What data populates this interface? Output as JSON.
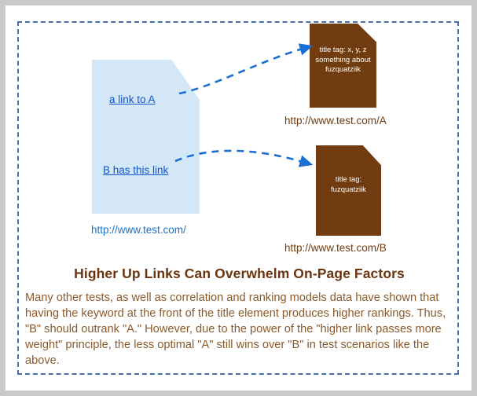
{
  "colors": {
    "frame_outer": "#c9c9c9",
    "frame_dashed": "#4a6fa8",
    "page_blue": "#d4e7f7",
    "page_brown": "#703c10",
    "link_blue": "#1155cc",
    "arrow_blue": "#1a6fd4",
    "headline_brown": "#6b3410",
    "body_brown": "#8a5a2b"
  },
  "diagram": {
    "source_page": {
      "name": "source page",
      "caption": "http://www.test.com/",
      "links": [
        {
          "label": "a link to A",
          "target": "page-a"
        },
        {
          "label": "B has this link",
          "target": "page-b"
        }
      ]
    },
    "target_pages": [
      {
        "id": "page-a",
        "title_tag_text": "title tag: x, y, z something about fuzquatziik",
        "caption": "http://www.test.com/A"
      },
      {
        "id": "page-b",
        "title_tag_text": "title tag: fuzquatziik",
        "caption": "http://www.test.com/B"
      }
    ],
    "arrows": [
      {
        "from": "a link to A",
        "to": "page-a",
        "style": "dashed-curved"
      },
      {
        "from": "B has this link",
        "to": "page-b",
        "style": "dashed-curved"
      }
    ]
  },
  "content": {
    "headline": "Higher Up Links Can Overwhelm On-Page Factors",
    "body": "Many other tests, as well as correlation and ranking models data have shown that having the keyword at the front of the title element produces higher rankings. Thus, \"B\" should outrank \"A.\" However, due to the power of the \"higher link passes more weight\" principle, the less optimal \"A\" still wins over \"B\" in test scenarios like the above."
  }
}
